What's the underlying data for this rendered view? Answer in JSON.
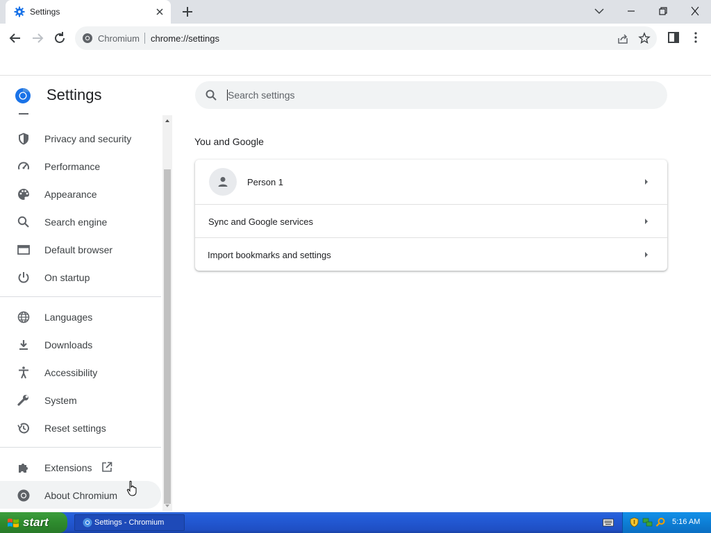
{
  "browser": {
    "tab_title": "Settings",
    "omnibox_site": "Chromium",
    "omnibox_url": "chrome://settings"
  },
  "page": {
    "title": "Settings",
    "search_placeholder": "Search settings"
  },
  "sidebar": {
    "items": [
      {
        "label": "Privacy and security",
        "icon": "shield-icon"
      },
      {
        "label": "Performance",
        "icon": "speedometer-icon"
      },
      {
        "label": "Appearance",
        "icon": "palette-icon"
      },
      {
        "label": "Search engine",
        "icon": "search-icon"
      },
      {
        "label": "Default browser",
        "icon": "browser-window-icon"
      },
      {
        "label": "On startup",
        "icon": "power-icon"
      },
      {
        "label": "Languages",
        "icon": "globe-icon"
      },
      {
        "label": "Downloads",
        "icon": "download-icon"
      },
      {
        "label": "Accessibility",
        "icon": "accessibility-icon"
      },
      {
        "label": "System",
        "icon": "wrench-icon"
      },
      {
        "label": "Reset settings",
        "icon": "history-icon"
      },
      {
        "label": "Extensions",
        "icon": "puzzle-icon"
      },
      {
        "label": "About Chromium",
        "icon": "chromium-icon"
      }
    ]
  },
  "main": {
    "section_title": "You and Google",
    "rows": [
      {
        "label": "Person 1"
      },
      {
        "label": "Sync and Google services"
      },
      {
        "label": "Import bookmarks and settings"
      }
    ]
  },
  "taskbar": {
    "start_label": "start",
    "task_label": "Settings - Chromium",
    "clock": "5:16 AM"
  },
  "colors": {
    "accent": "#1a73e8",
    "tabstrip": "#dee1e6",
    "taskbar": "#245edb",
    "start": "#2e8b2e"
  }
}
